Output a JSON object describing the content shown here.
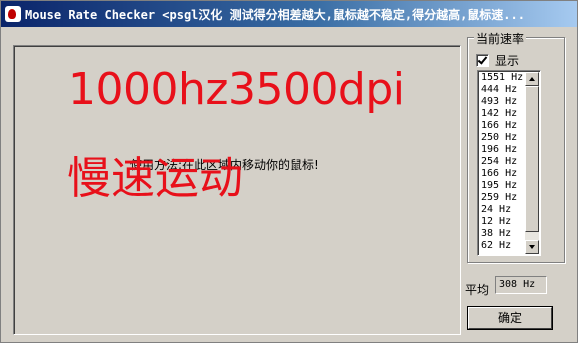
{
  "window": {
    "title": "Mouse Rate Checker <psgl汉化  测试得分相差越大,鼠标越不稳定,得分越高,鼠标速..."
  },
  "canvas": {
    "overlay_dpi_text": "1000hz3500dpi",
    "overlay_slow_text": "慢速运动",
    "instruction": "使用方法:在此区域内移动你的鼠标!"
  },
  "rate_panel": {
    "group_label": "当前速率",
    "show_label": "显示",
    "show_checked": true,
    "rates": [
      "1551 Hz",
      "444 Hz",
      "493 Hz",
      "142 Hz",
      "166 Hz",
      "250 Hz",
      "196 Hz",
      "254 Hz",
      "166 Hz",
      "195 Hz",
      "259 Hz",
      "24 Hz",
      "12 Hz",
      "38 Hz",
      "62 Hz"
    ]
  },
  "average": {
    "label": "平均",
    "value": "308 Hz"
  },
  "buttons": {
    "ok_label": "确定"
  },
  "colors": {
    "overlay_red": "#e8101a",
    "titlebar_start": "#0a246a",
    "titlebar_end": "#a6caf0",
    "face": "#d4d0c8"
  }
}
